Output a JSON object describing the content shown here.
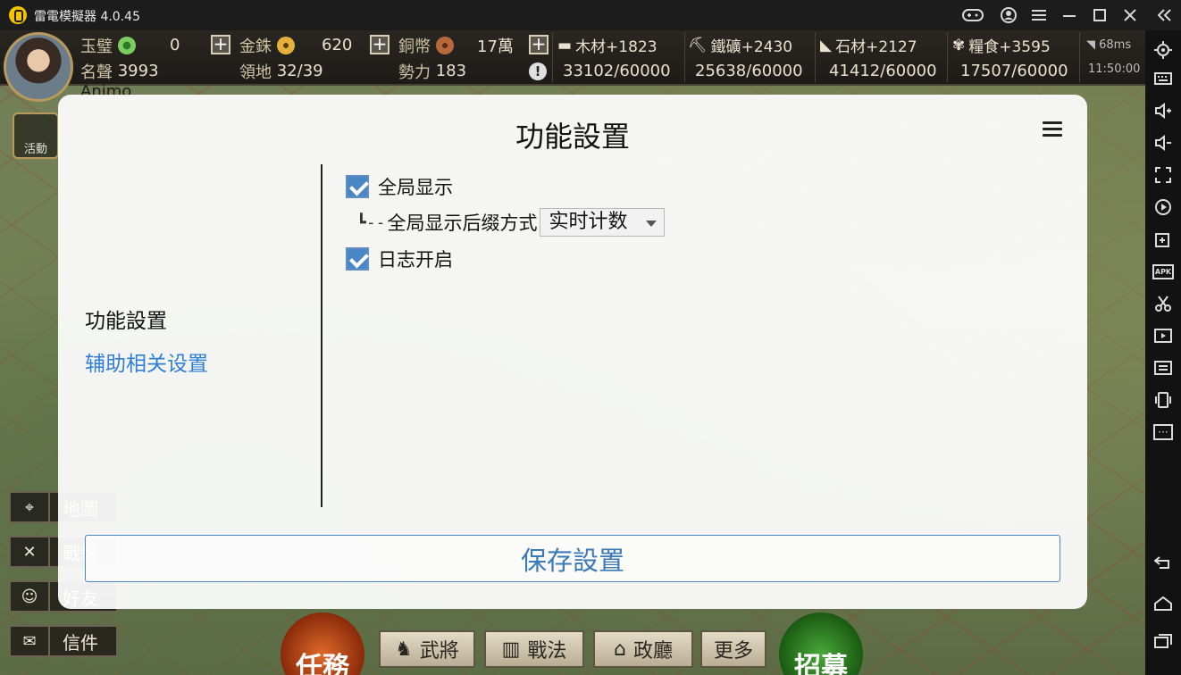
{
  "emulator": {
    "title": "雷電模擬器 4.0.45",
    "title_icons": [
      "gamepad-icon",
      "user-icon",
      "menu-icon",
      "minimize-icon",
      "maximize-icon",
      "close-icon",
      "collapse-icon"
    ],
    "side_icons": [
      "settings-icon",
      "keyboard-icon",
      "volume-up-icon",
      "volume-down-icon",
      "fullscreen-icon",
      "record-icon",
      "add-window-icon",
      "apk-icon",
      "scissors-icon",
      "video-icon",
      "sync-icon",
      "shake-icon",
      "more-icon",
      "back-icon",
      "home-icon",
      "recent-apps-icon"
    ],
    "side_labels": {
      "apk": "APK",
      "more": "···"
    }
  },
  "game": {
    "resources": {
      "jade": {
        "label": "玉璧",
        "value": "0"
      },
      "gold": {
        "label": "金銖",
        "value": "620"
      },
      "copper": {
        "label": "銅幣",
        "value": "17萬"
      },
      "fame": {
        "label": "名聲",
        "value": "3993"
      },
      "territory": {
        "label": "領地",
        "value": "32/39"
      },
      "power": {
        "label": "勢力",
        "value": "183"
      },
      "wood": {
        "label": "木材+1823",
        "value": "33102/60000"
      },
      "iron": {
        "label": "鐵礦+2430",
        "value": "25638/60000"
      },
      "stone": {
        "label": "石材+2127",
        "value": "41412/60000"
      },
      "food": {
        "label": "糧食+3595",
        "value": "17507/60000"
      },
      "ping": "68ms",
      "time": "11:50:00",
      "player_name": "Animo"
    },
    "left_buttons": [
      {
        "label": "地圖"
      },
      {
        "label": "戰報"
      },
      {
        "label": "好友"
      },
      {
        "label": "信件"
      }
    ],
    "bottom_buttons": {
      "task": "任務",
      "generals": "武將",
      "tactics": "戰法",
      "office": "政廳",
      "more": "更多",
      "recruit": "招募"
    },
    "activity_label": "活動"
  },
  "settings": {
    "title": "功能設置",
    "nav": [
      {
        "label": "功能設置",
        "active": true
      },
      {
        "label": "辅助相关设置",
        "active": false
      }
    ],
    "options": {
      "global_display": {
        "label": "全局显示",
        "checked": true
      },
      "suffix_mode": {
        "prefix": "┗--",
        "label": "全局显示后缀方式",
        "selected": "实时计数"
      },
      "log_enabled": {
        "label": "日志开启",
        "checked": true
      }
    },
    "save_label": "保存設置"
  },
  "colors": {
    "accent_blue": "#4a86c5",
    "save_text": "#3a78b8",
    "nav_active": "#111111",
    "nav_link": "#2f7fd6"
  }
}
